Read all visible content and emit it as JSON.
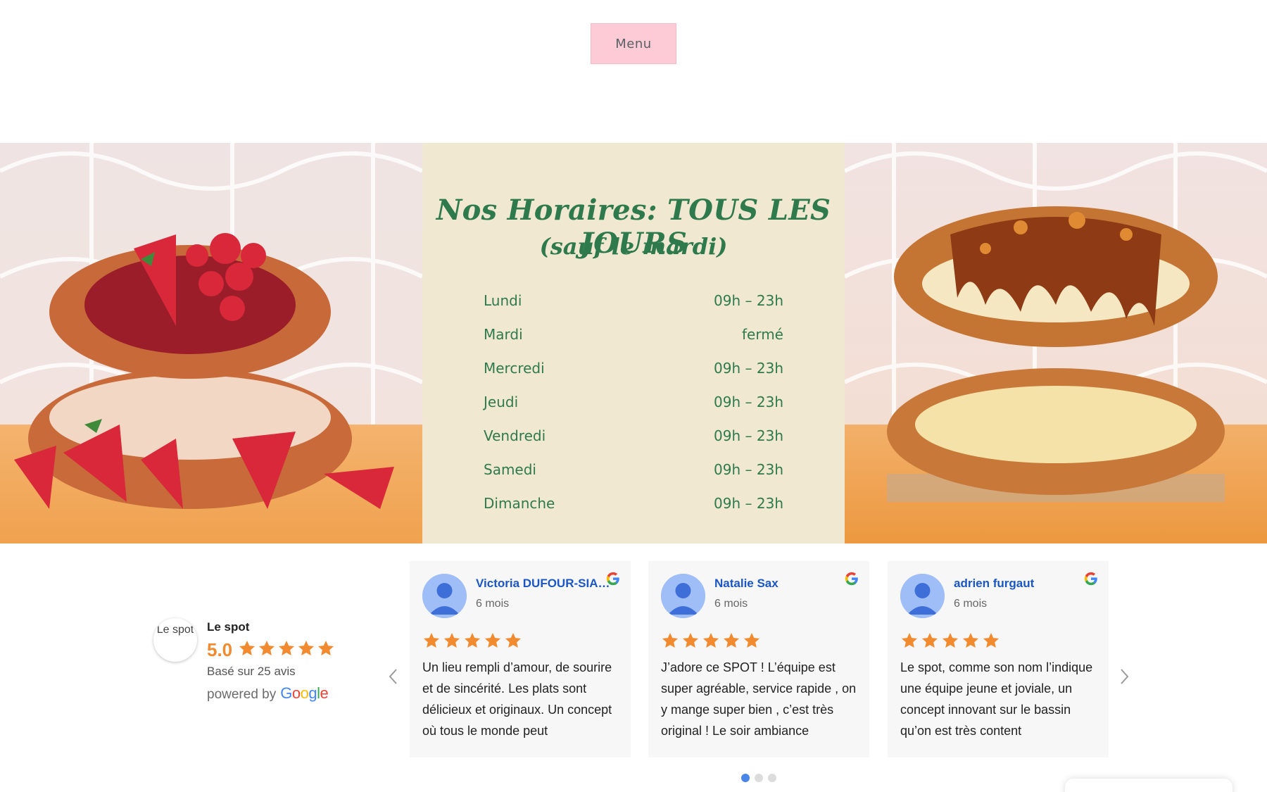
{
  "header": {
    "menu_label": "Menu"
  },
  "hours": {
    "title": "Nos Horaires: TOUS LES JOURS",
    "subtitle": "(sauf le mardi)",
    "rows": [
      {
        "day": "Lundi",
        "time": "09h – 23h"
      },
      {
        "day": "Mardi",
        "time": "fermé"
      },
      {
        "day": "Mercredi",
        "time": "09h – 23h"
      },
      {
        "day": "Jeudi",
        "time": "09h – 23h"
      },
      {
        "day": "Vendredi",
        "time": "09h – 23h"
      },
      {
        "day": "Samedi",
        "time": "09h – 23h"
      },
      {
        "day": "Dimanche",
        "time": "09h – 23h"
      }
    ]
  },
  "summary": {
    "avatar_text": "Le spot",
    "name": "Le spot",
    "score": "5.0",
    "rating": 5,
    "based_on": "Basé sur 25 avis",
    "powered_by": "powered by",
    "google": "Google"
  },
  "reviews": [
    {
      "name": "Victoria DUFOUR-SIA…",
      "time": "6 mois",
      "rating": 5,
      "text": "Un lieu rempli d’amour, de sourire et de sincérité. Les plats sont délicieux et originaux. Un concept où tous le monde peut"
    },
    {
      "name": "Natalie Sax",
      "time": "6 mois",
      "rating": 5,
      "text": "J’adore ce SPOT ! L’équipe est super agréable, service rapide , on y mange super bien , c’est très original ! Le soir ambiance"
    },
    {
      "name": "adrien furgaut",
      "time": "6 mois",
      "rating": 5,
      "text": "Le spot, comme son nom l’indique une équipe jeune et joviale, un concept innovant sur le bassin qu’on est très content"
    }
  ],
  "carousel": {
    "pages": 3,
    "active": 0
  },
  "colors": {
    "accent_green": "#2f7a4c",
    "star_orange": "#f28b30",
    "menu_pink": "#fccbd6",
    "panel_cream": "#f0e8d1",
    "link_blue": "#1a56c4"
  },
  "icons": {
    "prev": "chevron-left-icon",
    "next": "chevron-right-icon",
    "google": "google-g-icon",
    "star": "star-icon",
    "avatar": "user-avatar-icon"
  }
}
